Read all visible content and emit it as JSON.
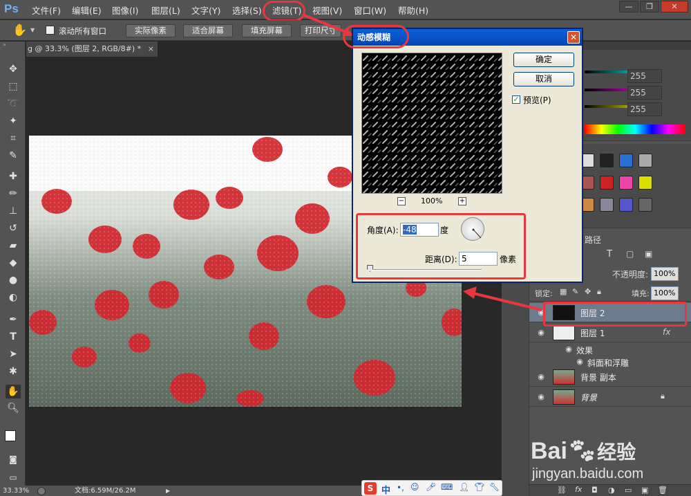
{
  "app": {
    "logo": "Ps"
  },
  "menu": {
    "file": "文件(F)",
    "edit": "编辑(E)",
    "image": "图像(I)",
    "layer": "图层(L)",
    "type": "文字(Y)",
    "select": "选择(S)",
    "filter": "滤镜(T)",
    "view": "视图(V)",
    "window": "窗口(W)",
    "help": "帮助(H)"
  },
  "window_controls": {
    "min": "—",
    "restore": "❐",
    "close": "✕"
  },
  "options": {
    "scroll_all": "滚动所有窗口",
    "actual_pixels": "实际像素",
    "fit_screen": "适合屏幕",
    "fill_screen": "填充屏幕",
    "print_size": "打印尺寸"
  },
  "doc": {
    "tab_title": "g @ 33.3% (图层 2, RGB/8#) *",
    "tab_close": "×"
  },
  "status": {
    "zoom": "33.33%",
    "doc_size": "文档:6.59M/26.2M"
  },
  "dialog": {
    "title": "动感模糊",
    "close": "✕",
    "ok": "确定",
    "cancel": "取消",
    "preview": "预览(P)",
    "zoom": "100%",
    "zoom_out": "−",
    "zoom_in": "+",
    "angle_label": "角度(A):",
    "angle_value": "-48",
    "angle_unit": "度",
    "distance_label": "距离(D):",
    "distance_value": "5",
    "distance_unit": "像素",
    "preview_checked": true
  },
  "color_panel": {
    "r": "255",
    "g": "255",
    "b": "255"
  },
  "layers_panel": {
    "tab_path": "路径",
    "opacity_label": "不透明度:",
    "opacity_value": "100%",
    "lock_label": "锁定:",
    "fill_label": "填充:",
    "fill_value": "100%",
    "layers": [
      {
        "name": "图层 2",
        "selected": true
      },
      {
        "name": "图层 1",
        "fx": "fx"
      },
      {
        "name": "效果"
      },
      {
        "name": "斜面和浮雕"
      },
      {
        "name": "背景 副本"
      },
      {
        "name": "背景"
      }
    ]
  },
  "watermark": {
    "brand": "Bai",
    "brand2": "经验",
    "url": "jingyan.baidu.com"
  },
  "taskbar": {
    "ime": "S",
    "ime_lang": "中"
  },
  "colors": {
    "highlight": "#e8383d",
    "xp_title": "#0a5fd8",
    "ps_bg": "#535353"
  }
}
